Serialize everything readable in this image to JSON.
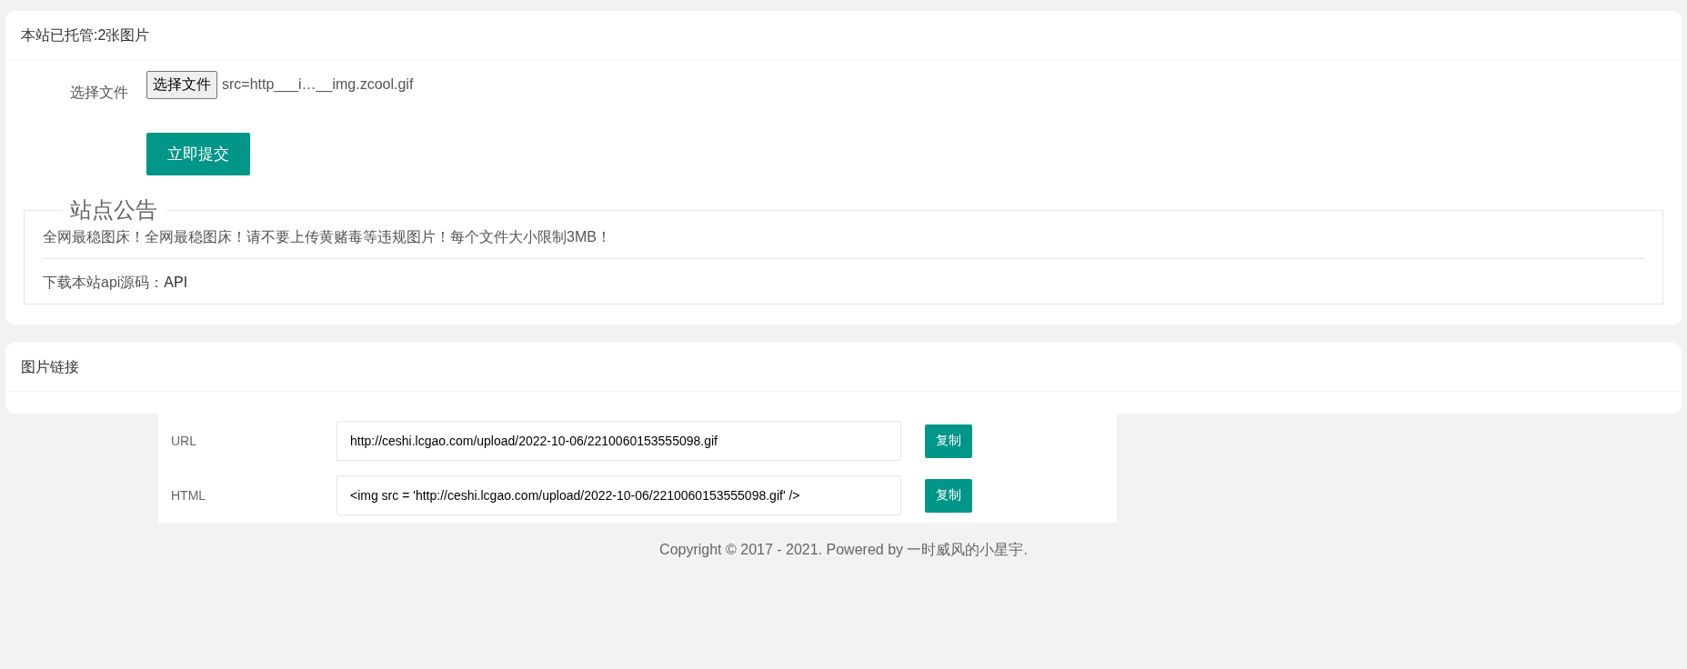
{
  "upload_card": {
    "title": "本站已托管:2张图片",
    "file_label": "选择文件",
    "file_button": "选择文件",
    "file_name": "src=http___i…__img.zcool.gif",
    "submit_button": "立即提交"
  },
  "notice": {
    "legend": "站点公告",
    "message": "全网最稳图床！全网最稳图床！请不要上传黄赌毒等违规图片！每个文件大小限制3MB！",
    "api_text": "下载本站api源码：",
    "api_link": "API"
  },
  "links_card": {
    "title": "图片链接"
  },
  "links": [
    {
      "label": "URL",
      "value": "http://ceshi.lcgao.com/upload/2022-10-06/2210060153555098.gif",
      "button": "复制"
    },
    {
      "label": "HTML",
      "value": "<img src = 'http://ceshi.lcgao.com/upload/2022-10-06/2210060153555098.gif' />",
      "button": "复制"
    }
  ],
  "footer": "Copyright © 2017 - 2021. Powered by 一时威风的小星宇."
}
